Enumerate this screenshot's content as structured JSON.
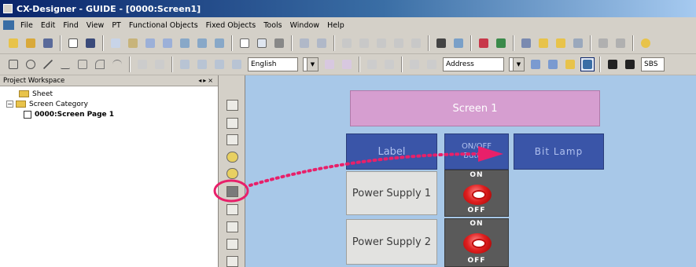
{
  "window": {
    "title": "CX-Designer - GUIDE - [0000:Screen1]"
  },
  "menu": {
    "items": [
      "File",
      "Edit",
      "Find",
      "View",
      "PT",
      "Functional Objects",
      "Fixed Objects",
      "Tools",
      "Window",
      "Help"
    ]
  },
  "toolbar2": {
    "language_value": "English",
    "address_value": "Address",
    "extra_value": "SBS"
  },
  "workspace": {
    "title": "Project Workspace",
    "tree": {
      "sheet": "Sheet",
      "category": "Screen Category",
      "page": "0000:Screen Page 1"
    }
  },
  "canvas": {
    "screen_title": "Screen 1",
    "label_object": "Label",
    "onoff_line1": "ON/OFF",
    "onoff_line2": "Button",
    "bit_lamp": "Bit Lamp",
    "power_supply_1": "Power Supply 1",
    "power_supply_2": "Power Supply 2",
    "switch_on": "ON",
    "switch_off": "OFF"
  },
  "colors": {
    "canvas_bg": "#a8c8e8",
    "screen_title_bg": "#d69ed0",
    "object_blue": "#3a55a8",
    "annotation": "#e8206a"
  }
}
